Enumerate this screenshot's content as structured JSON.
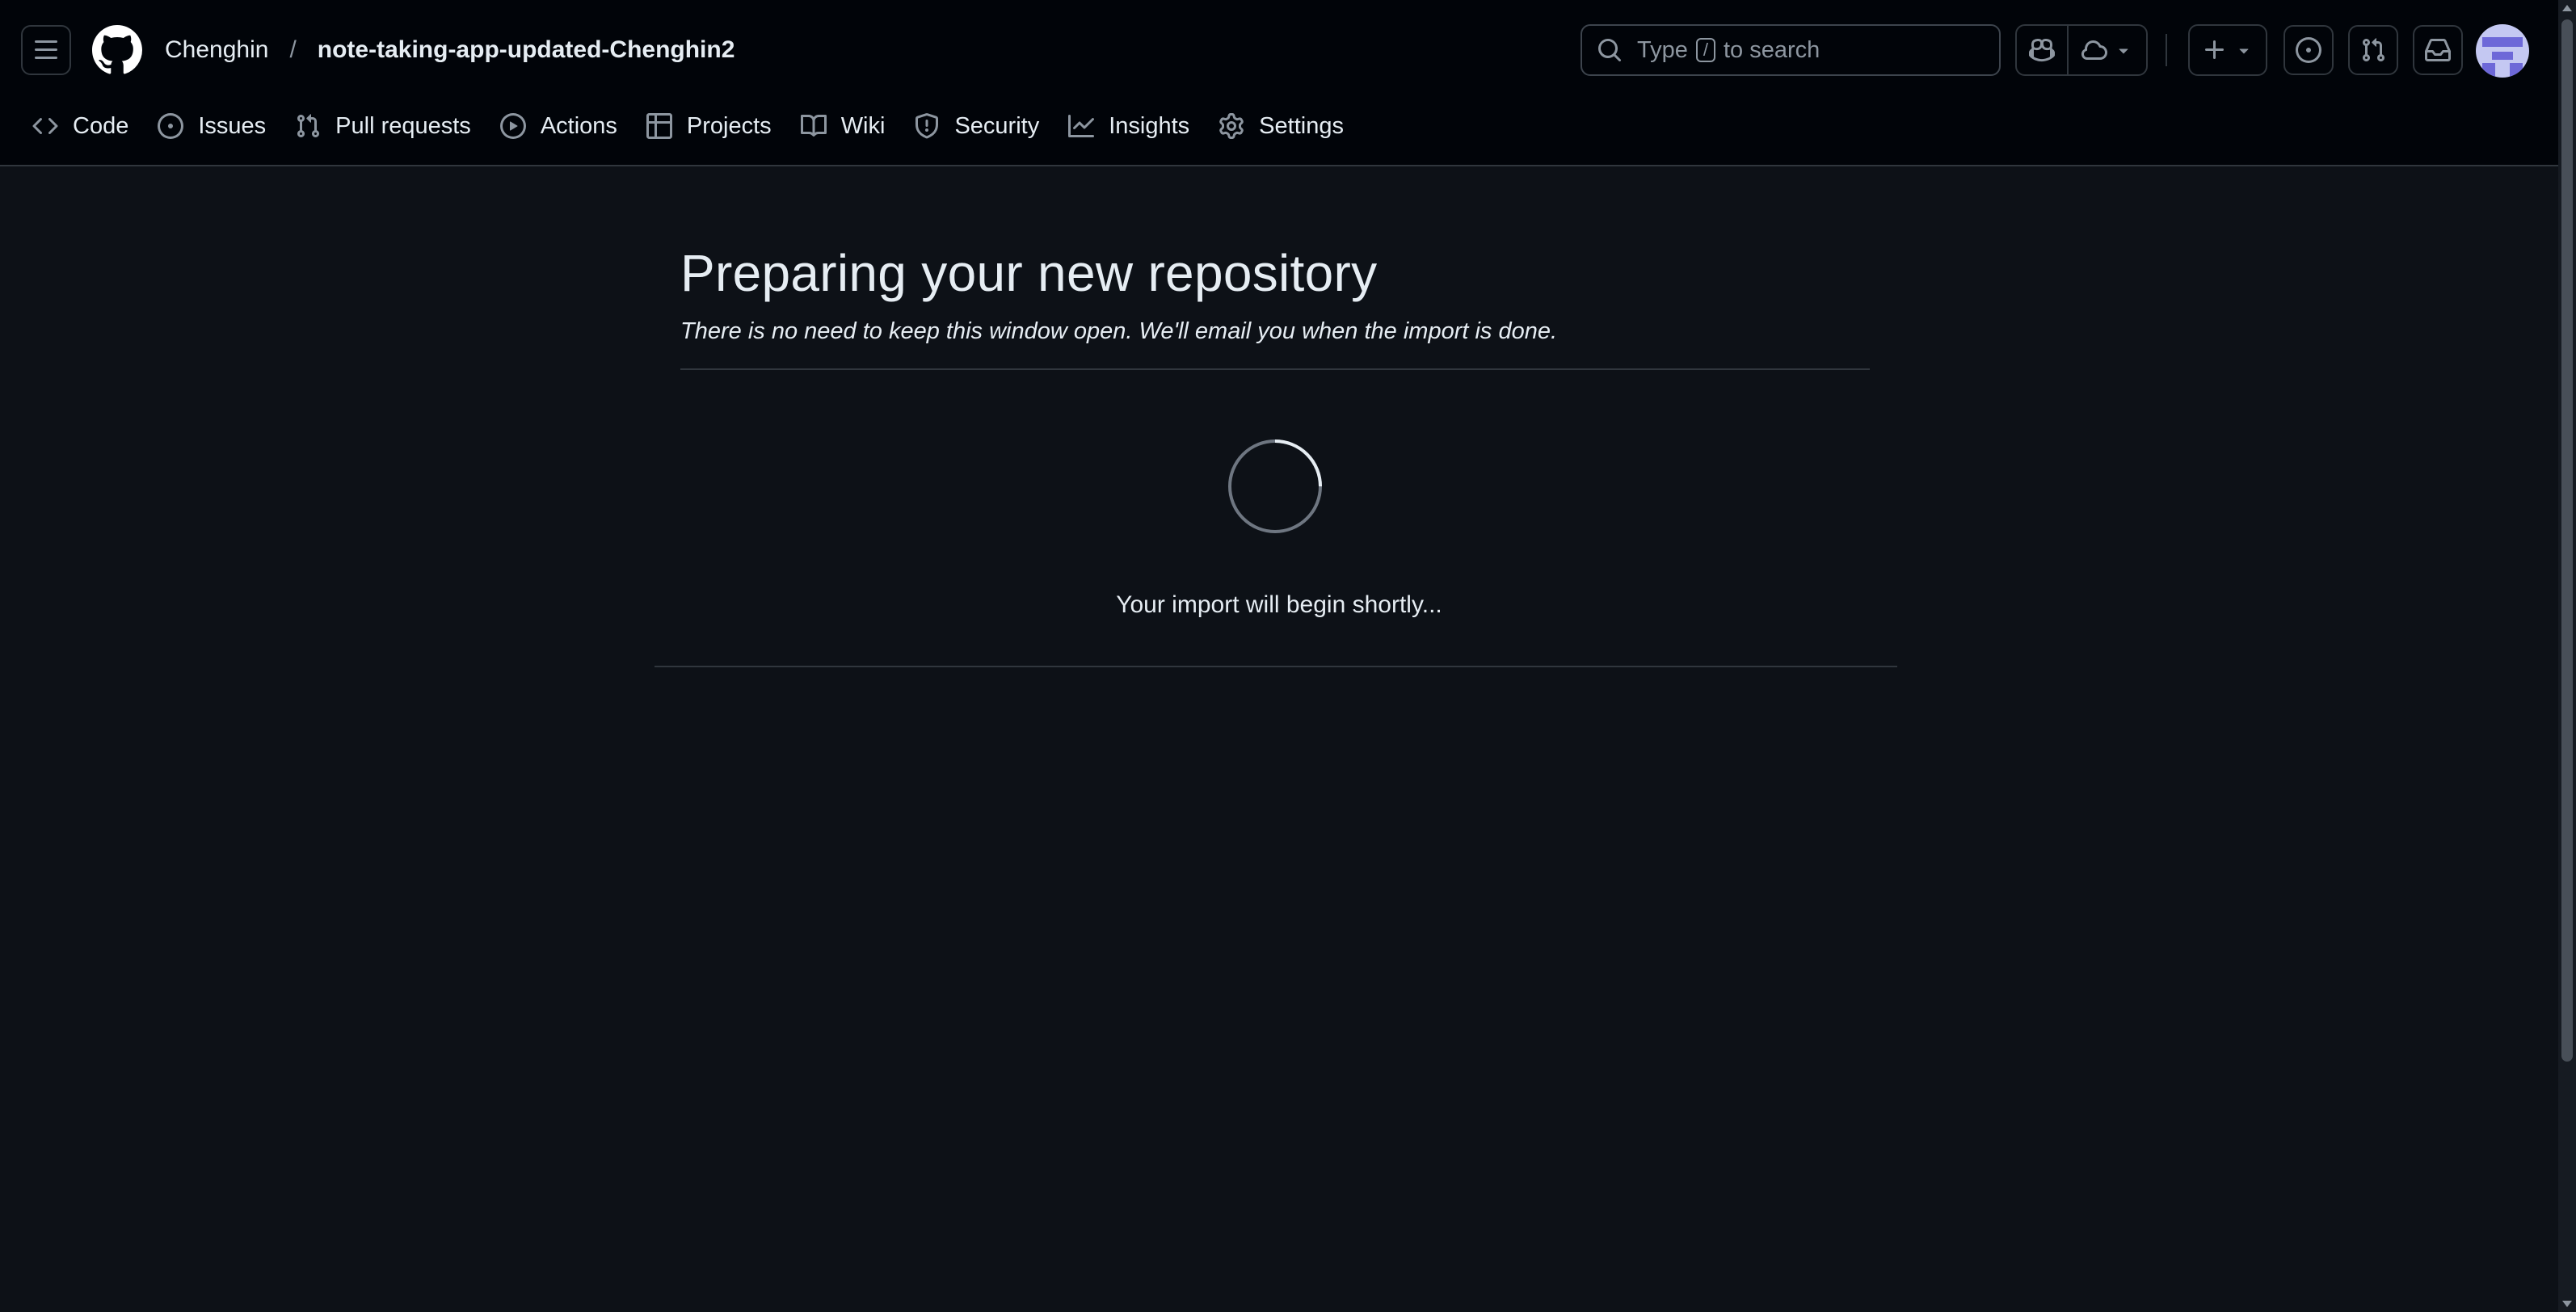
{
  "header": {
    "owner": "Chenghin",
    "separator": "/",
    "repo": "note-taking-app-updated-Chenghin2",
    "search": {
      "prefix": "Type",
      "key": "/",
      "suffix": "to search"
    }
  },
  "nav": {
    "tabs": [
      {
        "label": "Code",
        "icon": "code-icon"
      },
      {
        "label": "Issues",
        "icon": "issue-opened-icon"
      },
      {
        "label": "Pull requests",
        "icon": "git-pull-request-icon"
      },
      {
        "label": "Actions",
        "icon": "play-icon"
      },
      {
        "label": "Projects",
        "icon": "table-icon"
      },
      {
        "label": "Wiki",
        "icon": "book-icon"
      },
      {
        "label": "Security",
        "icon": "shield-icon"
      },
      {
        "label": "Insights",
        "icon": "graph-icon"
      },
      {
        "label": "Settings",
        "icon": "gear-icon"
      }
    ]
  },
  "main": {
    "title": "Preparing your new repository",
    "subtitle": "There is no need to keep this window open. We'll email you when the import is done.",
    "status": "Your import will begin shortly..."
  },
  "colors": {
    "background": "#0d1117",
    "header": "#010409",
    "border": "#30363d",
    "muted": "#8d96a0",
    "text": "#e6edf3"
  }
}
